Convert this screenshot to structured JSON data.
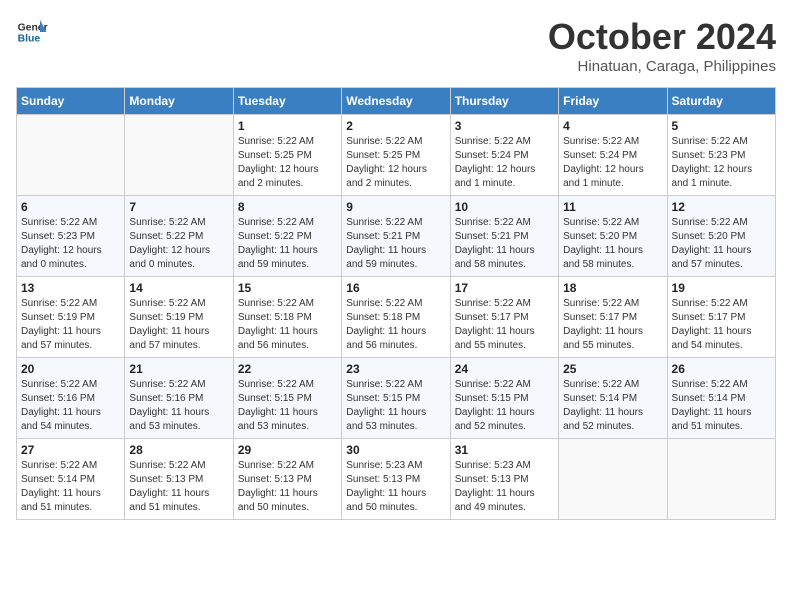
{
  "logo": {
    "line1": "General",
    "line2": "Blue"
  },
  "title": "October 2024",
  "location": "Hinatuan, Caraga, Philippines",
  "days_of_week": [
    "Sunday",
    "Monday",
    "Tuesday",
    "Wednesday",
    "Thursday",
    "Friday",
    "Saturday"
  ],
  "weeks": [
    [
      {
        "day": "",
        "info": ""
      },
      {
        "day": "",
        "info": ""
      },
      {
        "day": "1",
        "info": "Sunrise: 5:22 AM\nSunset: 5:25 PM\nDaylight: 12 hours\nand 2 minutes."
      },
      {
        "day": "2",
        "info": "Sunrise: 5:22 AM\nSunset: 5:25 PM\nDaylight: 12 hours\nand 2 minutes."
      },
      {
        "day": "3",
        "info": "Sunrise: 5:22 AM\nSunset: 5:24 PM\nDaylight: 12 hours\nand 1 minute."
      },
      {
        "day": "4",
        "info": "Sunrise: 5:22 AM\nSunset: 5:24 PM\nDaylight: 12 hours\nand 1 minute."
      },
      {
        "day": "5",
        "info": "Sunrise: 5:22 AM\nSunset: 5:23 PM\nDaylight: 12 hours\nand 1 minute."
      }
    ],
    [
      {
        "day": "6",
        "info": "Sunrise: 5:22 AM\nSunset: 5:23 PM\nDaylight: 12 hours\nand 0 minutes."
      },
      {
        "day": "7",
        "info": "Sunrise: 5:22 AM\nSunset: 5:22 PM\nDaylight: 12 hours\nand 0 minutes."
      },
      {
        "day": "8",
        "info": "Sunrise: 5:22 AM\nSunset: 5:22 PM\nDaylight: 11 hours\nand 59 minutes."
      },
      {
        "day": "9",
        "info": "Sunrise: 5:22 AM\nSunset: 5:21 PM\nDaylight: 11 hours\nand 59 minutes."
      },
      {
        "day": "10",
        "info": "Sunrise: 5:22 AM\nSunset: 5:21 PM\nDaylight: 11 hours\nand 58 minutes."
      },
      {
        "day": "11",
        "info": "Sunrise: 5:22 AM\nSunset: 5:20 PM\nDaylight: 11 hours\nand 58 minutes."
      },
      {
        "day": "12",
        "info": "Sunrise: 5:22 AM\nSunset: 5:20 PM\nDaylight: 11 hours\nand 57 minutes."
      }
    ],
    [
      {
        "day": "13",
        "info": "Sunrise: 5:22 AM\nSunset: 5:19 PM\nDaylight: 11 hours\nand 57 minutes."
      },
      {
        "day": "14",
        "info": "Sunrise: 5:22 AM\nSunset: 5:19 PM\nDaylight: 11 hours\nand 57 minutes."
      },
      {
        "day": "15",
        "info": "Sunrise: 5:22 AM\nSunset: 5:18 PM\nDaylight: 11 hours\nand 56 minutes."
      },
      {
        "day": "16",
        "info": "Sunrise: 5:22 AM\nSunset: 5:18 PM\nDaylight: 11 hours\nand 56 minutes."
      },
      {
        "day": "17",
        "info": "Sunrise: 5:22 AM\nSunset: 5:17 PM\nDaylight: 11 hours\nand 55 minutes."
      },
      {
        "day": "18",
        "info": "Sunrise: 5:22 AM\nSunset: 5:17 PM\nDaylight: 11 hours\nand 55 minutes."
      },
      {
        "day": "19",
        "info": "Sunrise: 5:22 AM\nSunset: 5:17 PM\nDaylight: 11 hours\nand 54 minutes."
      }
    ],
    [
      {
        "day": "20",
        "info": "Sunrise: 5:22 AM\nSunset: 5:16 PM\nDaylight: 11 hours\nand 54 minutes."
      },
      {
        "day": "21",
        "info": "Sunrise: 5:22 AM\nSunset: 5:16 PM\nDaylight: 11 hours\nand 53 minutes."
      },
      {
        "day": "22",
        "info": "Sunrise: 5:22 AM\nSunset: 5:15 PM\nDaylight: 11 hours\nand 53 minutes."
      },
      {
        "day": "23",
        "info": "Sunrise: 5:22 AM\nSunset: 5:15 PM\nDaylight: 11 hours\nand 53 minutes."
      },
      {
        "day": "24",
        "info": "Sunrise: 5:22 AM\nSunset: 5:15 PM\nDaylight: 11 hours\nand 52 minutes."
      },
      {
        "day": "25",
        "info": "Sunrise: 5:22 AM\nSunset: 5:14 PM\nDaylight: 11 hours\nand 52 minutes."
      },
      {
        "day": "26",
        "info": "Sunrise: 5:22 AM\nSunset: 5:14 PM\nDaylight: 11 hours\nand 51 minutes."
      }
    ],
    [
      {
        "day": "27",
        "info": "Sunrise: 5:22 AM\nSunset: 5:14 PM\nDaylight: 11 hours\nand 51 minutes."
      },
      {
        "day": "28",
        "info": "Sunrise: 5:22 AM\nSunset: 5:13 PM\nDaylight: 11 hours\nand 51 minutes."
      },
      {
        "day": "29",
        "info": "Sunrise: 5:22 AM\nSunset: 5:13 PM\nDaylight: 11 hours\nand 50 minutes."
      },
      {
        "day": "30",
        "info": "Sunrise: 5:23 AM\nSunset: 5:13 PM\nDaylight: 11 hours\nand 50 minutes."
      },
      {
        "day": "31",
        "info": "Sunrise: 5:23 AM\nSunset: 5:13 PM\nDaylight: 11 hours\nand 49 minutes."
      },
      {
        "day": "",
        "info": ""
      },
      {
        "day": "",
        "info": ""
      }
    ]
  ]
}
